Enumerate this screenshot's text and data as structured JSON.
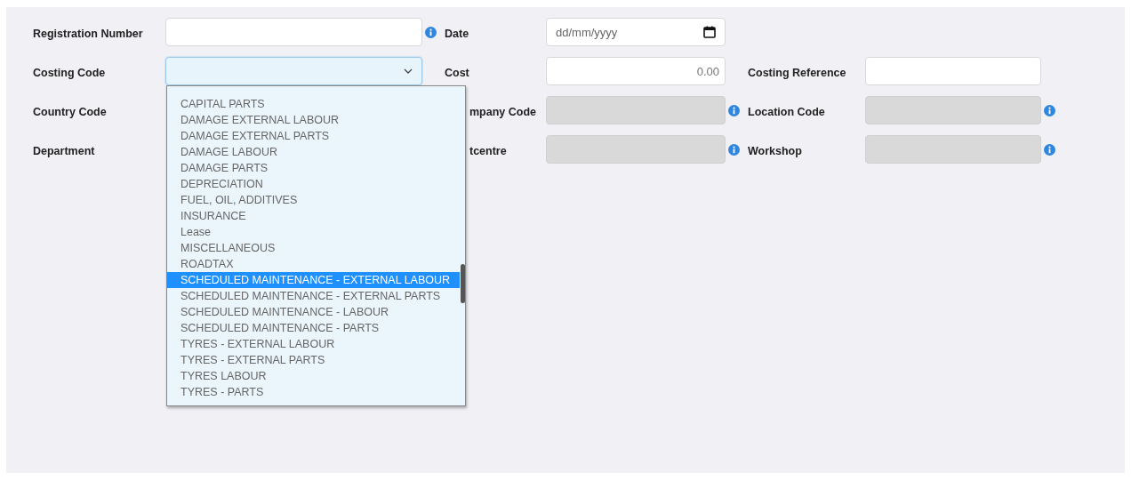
{
  "rows": [
    {
      "cells": [
        {
          "label": "Registration Number",
          "kind": "text",
          "info": true
        },
        {
          "label": "Date",
          "kind": "date",
          "placeholder": "dd/mm/yyyy"
        },
        {
          "kind": "empty"
        }
      ]
    },
    {
      "cells": [
        {
          "label": "Costing Code",
          "kind": "select",
          "expanded": true,
          "options": [
            {
              "label": "CAPITAL PARTS",
              "selected": false
            },
            {
              "label": "DAMAGE EXTERNAL LABOUR",
              "selected": false
            },
            {
              "label": "DAMAGE EXTERNAL PARTS",
              "selected": false
            },
            {
              "label": "DAMAGE LABOUR",
              "selected": false
            },
            {
              "label": "DAMAGE PARTS",
              "selected": false
            },
            {
              "label": "DEPRECIATION",
              "selected": false
            },
            {
              "label": "FUEL, OIL, ADDITIVES",
              "selected": false
            },
            {
              "label": "INSURANCE",
              "selected": false
            },
            {
              "label": "Lease",
              "selected": false
            },
            {
              "label": "MISCELLANEOUS",
              "selected": false
            },
            {
              "label": "ROADTAX",
              "selected": false
            },
            {
              "label": "SCHEDULED MAINTENANCE - EXTERNAL LABOUR",
              "selected": true
            },
            {
              "label": "SCHEDULED MAINTENANCE - EXTERNAL PARTS",
              "selected": false
            },
            {
              "label": "SCHEDULED MAINTENANCE - LABOUR",
              "selected": false
            },
            {
              "label": "SCHEDULED MAINTENANCE - PARTS",
              "selected": false
            },
            {
              "label": "TYRES - EXTERNAL LABOUR",
              "selected": false
            },
            {
              "label": "TYRES - EXTERNAL PARTS",
              "selected": false
            },
            {
              "label": "TYRES LABOUR",
              "selected": false
            },
            {
              "label": "TYRES - PARTS",
              "selected": false
            }
          ]
        },
        {
          "label": "Cost",
          "kind": "number",
          "placeholder": "0.00"
        },
        {
          "label": "Costing Reference",
          "kind": "text"
        }
      ]
    },
    {
      "cells": [
        {
          "label": "Country Code",
          "kind": "covered"
        },
        {
          "label": "mpany Code",
          "kind": "text",
          "disabled": true,
          "info": true
        },
        {
          "label": "Location Code",
          "kind": "text",
          "disabled": true,
          "info": true
        }
      ]
    },
    {
      "cells": [
        {
          "label": "Department",
          "kind": "covered"
        },
        {
          "label": "tcentre",
          "kind": "text",
          "disabled": true,
          "info": true
        },
        {
          "label": "Workshop",
          "kind": "text",
          "disabled": true,
          "info": true
        }
      ]
    }
  ]
}
